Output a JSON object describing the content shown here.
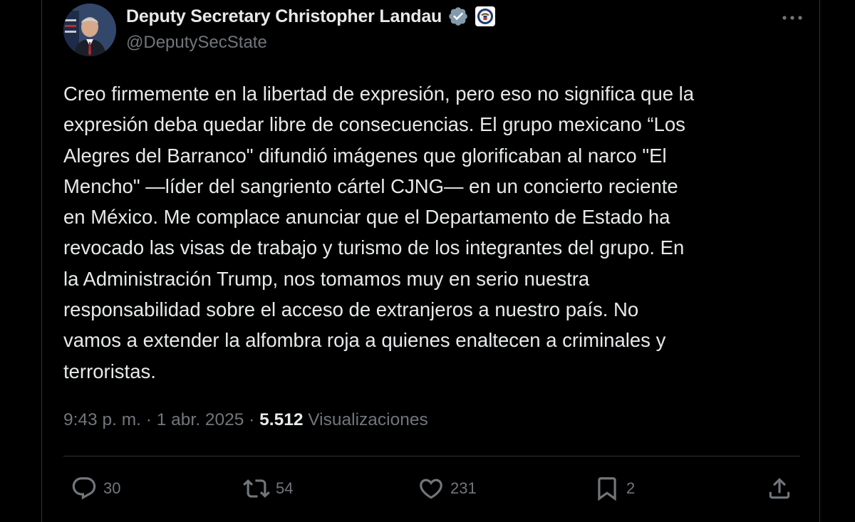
{
  "tweet": {
    "author": {
      "display_name": "Deputy Secretary Christopher Landau",
      "handle": "@DeputySecState",
      "verified_icon": "verified-badge-icon",
      "affiliation_icon": "state-department-seal-icon"
    },
    "text": "Creo firmemente en la libertad de expresión, pero eso no significa que la\nexpresión deba quedar libre de consecuencias. El grupo mexicano “Los\nAlegres del Barranco\" difundió imágenes que glorificaban al narco \"El\nMencho\" —líder del sangriento cártel CJNG— en un concierto reciente\nen México. Me complace anunciar que el Departamento de Estado ha\nrevocado las visas de trabajo y turismo de los integrantes del grupo. En\nla Administración Trump, nos tomamos muy en serio nuestra\nresponsabilidad sobre el acceso de extranjeros a nuestro país. No\nvamos a extender la alfombra roja a quienes enaltecen a criminales y\nterroristas.",
    "time": "9:43 p. m.",
    "separator": "·",
    "date": "1 abr. 2025",
    "views_count": "5.512",
    "views_label": "Visualizaciones"
  },
  "actions": {
    "replies": "30",
    "reposts": "54",
    "likes": "231",
    "bookmarks": "2"
  },
  "colors": {
    "background": "#000000",
    "text_primary": "#e7e9ea",
    "text_secondary": "#71767b",
    "divider": "#2f3336",
    "verified_blue": "#1d9bf0"
  }
}
